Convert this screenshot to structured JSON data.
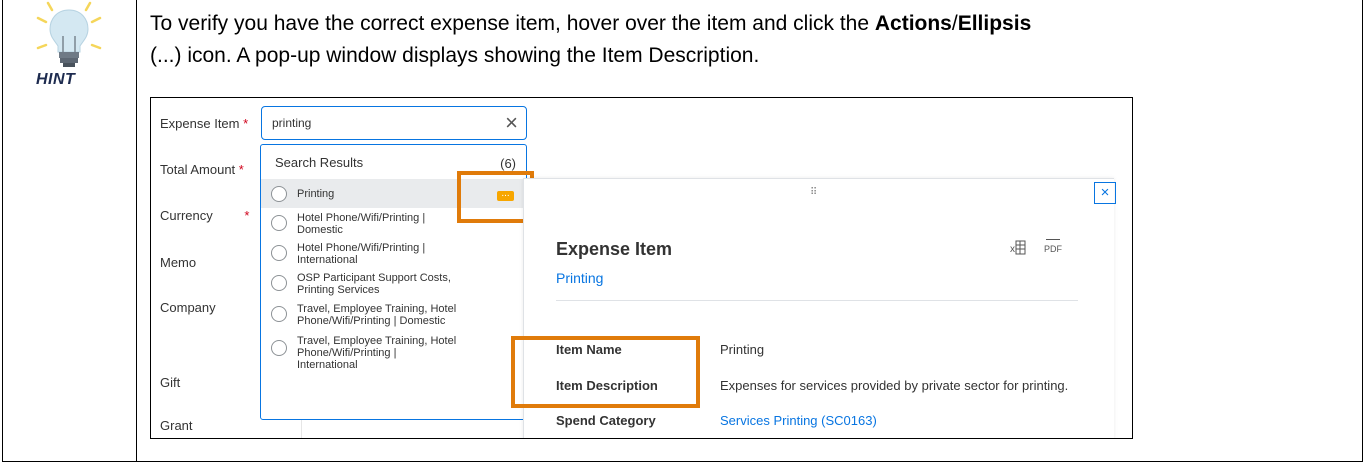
{
  "hint": {
    "label": "HINT"
  },
  "instruction": {
    "part1": "To verify you have the correct expense item, hover over the item and click the ",
    "bold1": "Actions",
    "slash": "/",
    "bold2": "Ellipsis",
    "part2": "(...) icon.  A pop-up window displays showing the Item Description."
  },
  "form": {
    "labels": {
      "expense_item": "Expense Item",
      "total_amount": "Total Amount",
      "currency": "Currency",
      "memo": "Memo",
      "company": "Company",
      "gift": "Gift",
      "grant": "Grant"
    },
    "required_mark": "*",
    "search_value": "printing",
    "clear_icon": "×"
  },
  "dropdown": {
    "title": "Search Results",
    "count": "(6)",
    "items": [
      {
        "label": "Printing"
      },
      {
        "label": "Hotel Phone/Wifi/Printing |\nDomestic"
      },
      {
        "label": "Hotel Phone/Wifi/Printing |\nInternational"
      },
      {
        "label": "OSP Participant Support Costs,\nPrinting Services"
      },
      {
        "label": "Travel, Employee Training, Hotel\nPhone/Wifi/Printing | Domestic"
      },
      {
        "label": "Travel, Employee Training, Hotel\nPhone/Wifi/Printing |\nInternational"
      }
    ],
    "ellipsis": "..."
  },
  "panel": {
    "drag": "⠿",
    "close": "×",
    "title": "Expense Item",
    "subtitle": "Printing",
    "pdf_label": "PDF",
    "rows": [
      {
        "label": "Item Name",
        "value": "Printing"
      },
      {
        "label": "Item Description",
        "value": "Expenses for services provided by private sector for printing."
      },
      {
        "label": "Spend Category",
        "value": "Services Printing (SC0163)"
      }
    ]
  },
  "colors": {
    "accent": "#0875e1",
    "highlight": "#e07b0a",
    "ellipsis": "#f7a600",
    "required": "#d0021b"
  },
  "icons": {
    "hint": "lightbulb-icon",
    "excel": "excel-export-icon",
    "pdf": "pdf-export-icon",
    "close": "close-icon",
    "drag": "drag-handle-icon",
    "ellipsis": "ellipsis-icon"
  }
}
